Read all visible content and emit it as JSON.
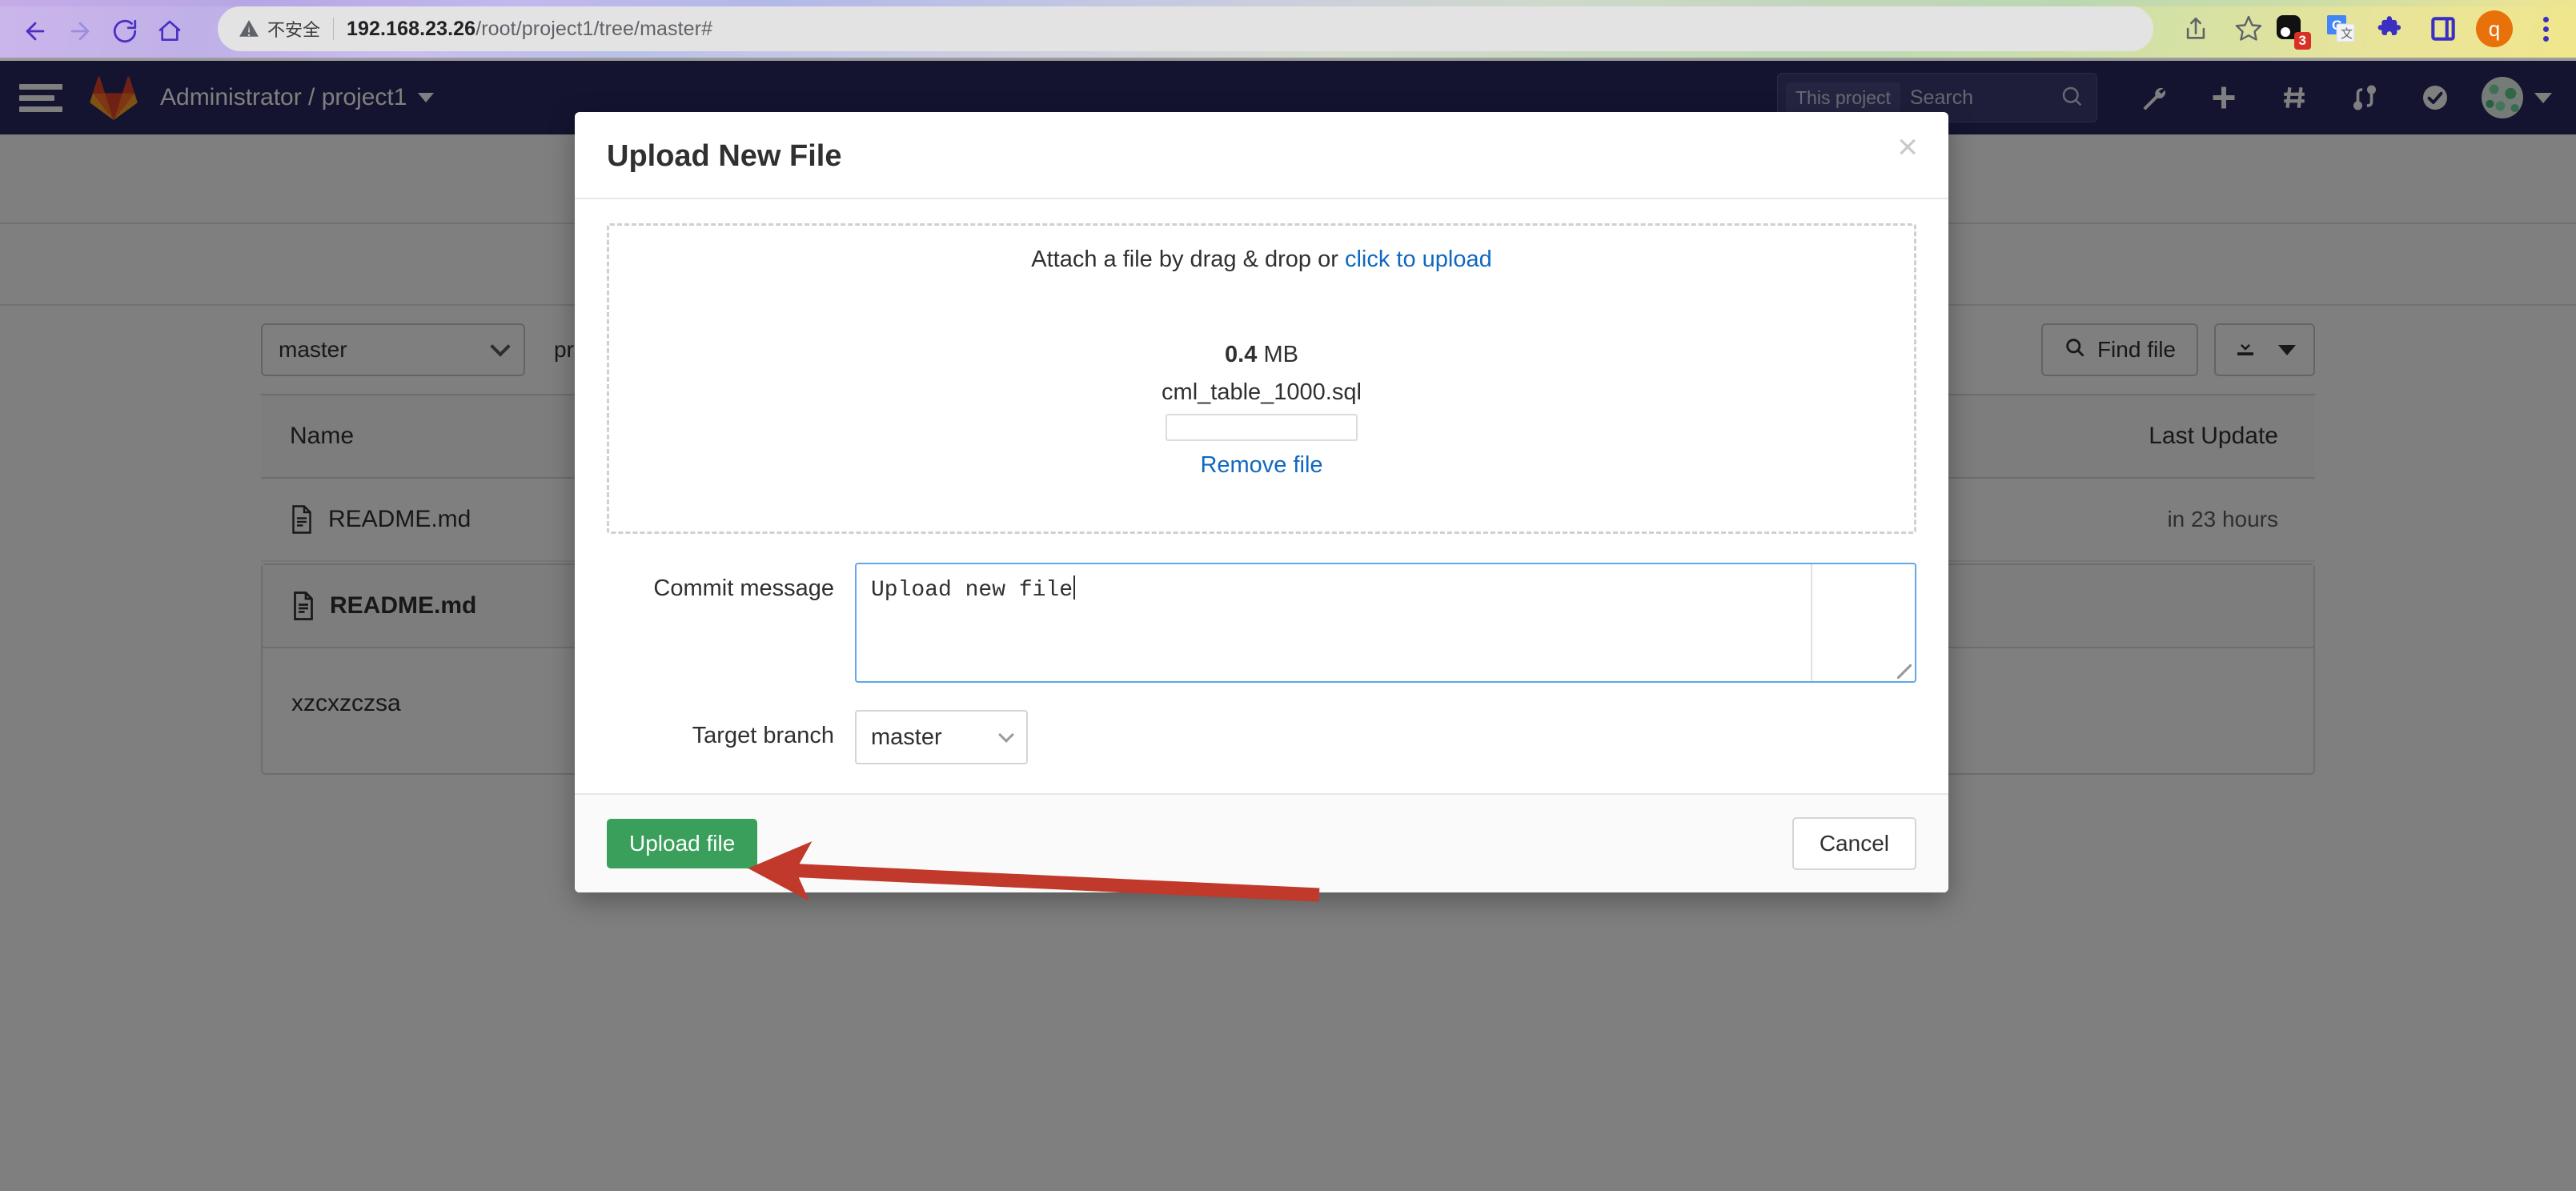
{
  "browser": {
    "nav": {
      "back": "back-arrow",
      "forward": "forward-arrow",
      "reload": "reload-arrow",
      "home": "home-icon"
    },
    "security_label": "不安全",
    "url_host": "192.168.23.26",
    "url_path": "/root/project1/tree/master#",
    "share_icon": "share-icon",
    "bookmark_icon": "star-icon",
    "extensions": [
      {
        "name": "notes-extension-icon",
        "badge": "3"
      },
      {
        "name": "google-translate-icon",
        "badge": ""
      },
      {
        "name": "puzzle-extensions-icon",
        "badge": ""
      },
      {
        "name": "sidepanel-icon",
        "badge": ""
      }
    ],
    "profile_initial": "q",
    "menu_icon": "kebab-menu-icon"
  },
  "gitlab": {
    "hamburger": "hamburger-menu-icon",
    "logo": "gitlab-logo-icon",
    "breadcrumb": "Administrator / project1",
    "search": {
      "scope": "This project",
      "placeholder": "Search",
      "icon": "search-icon"
    },
    "header_icons": [
      "wrench-icon",
      "plus-icon",
      "issues-hash-icon",
      "merge-requests-icon",
      "todos-check-icon"
    ],
    "avatar": "user-avatar"
  },
  "repo": {
    "branch": "master",
    "breadcrumb_path": "pro",
    "find_file": "Find file",
    "find_file_icon": "search-icon",
    "download_icon": "download-icon",
    "table": {
      "columns": [
        "Name",
        "Last Update"
      ],
      "rows": [
        {
          "name": "README.md",
          "icon": "file-doc-icon",
          "last_update": "in 23 hours"
        }
      ]
    },
    "readme": {
      "title": "README.md",
      "icon": "file-doc-icon",
      "content": "xzcxzczsa"
    }
  },
  "modal": {
    "title": "Upload New File",
    "close_label": "×",
    "dropzone": {
      "prompt_prefix": "Attach a file by drag & drop or ",
      "prompt_link": "click to upload",
      "file_size_value": "0.4",
      "file_size_unit": "MB",
      "file_name": "cml_table_1000.sql",
      "remove_label": "Remove file"
    },
    "commit": {
      "label": "Commit message",
      "value": "Upload new file"
    },
    "target_branch": {
      "label": "Target branch",
      "value": "master"
    },
    "footer": {
      "submit_label": "Upload file",
      "cancel_label": "Cancel"
    }
  },
  "annotation": {
    "arrow_color": "#c0392b",
    "points_to": "Upload file"
  },
  "colors": {
    "gitlab_header": "#292961",
    "primary_green": "#3a9f5a",
    "link_blue": "#1068bf",
    "focus_blue": "#63a6e9",
    "backdrop": "rgba(0,0,0,0.5)"
  }
}
